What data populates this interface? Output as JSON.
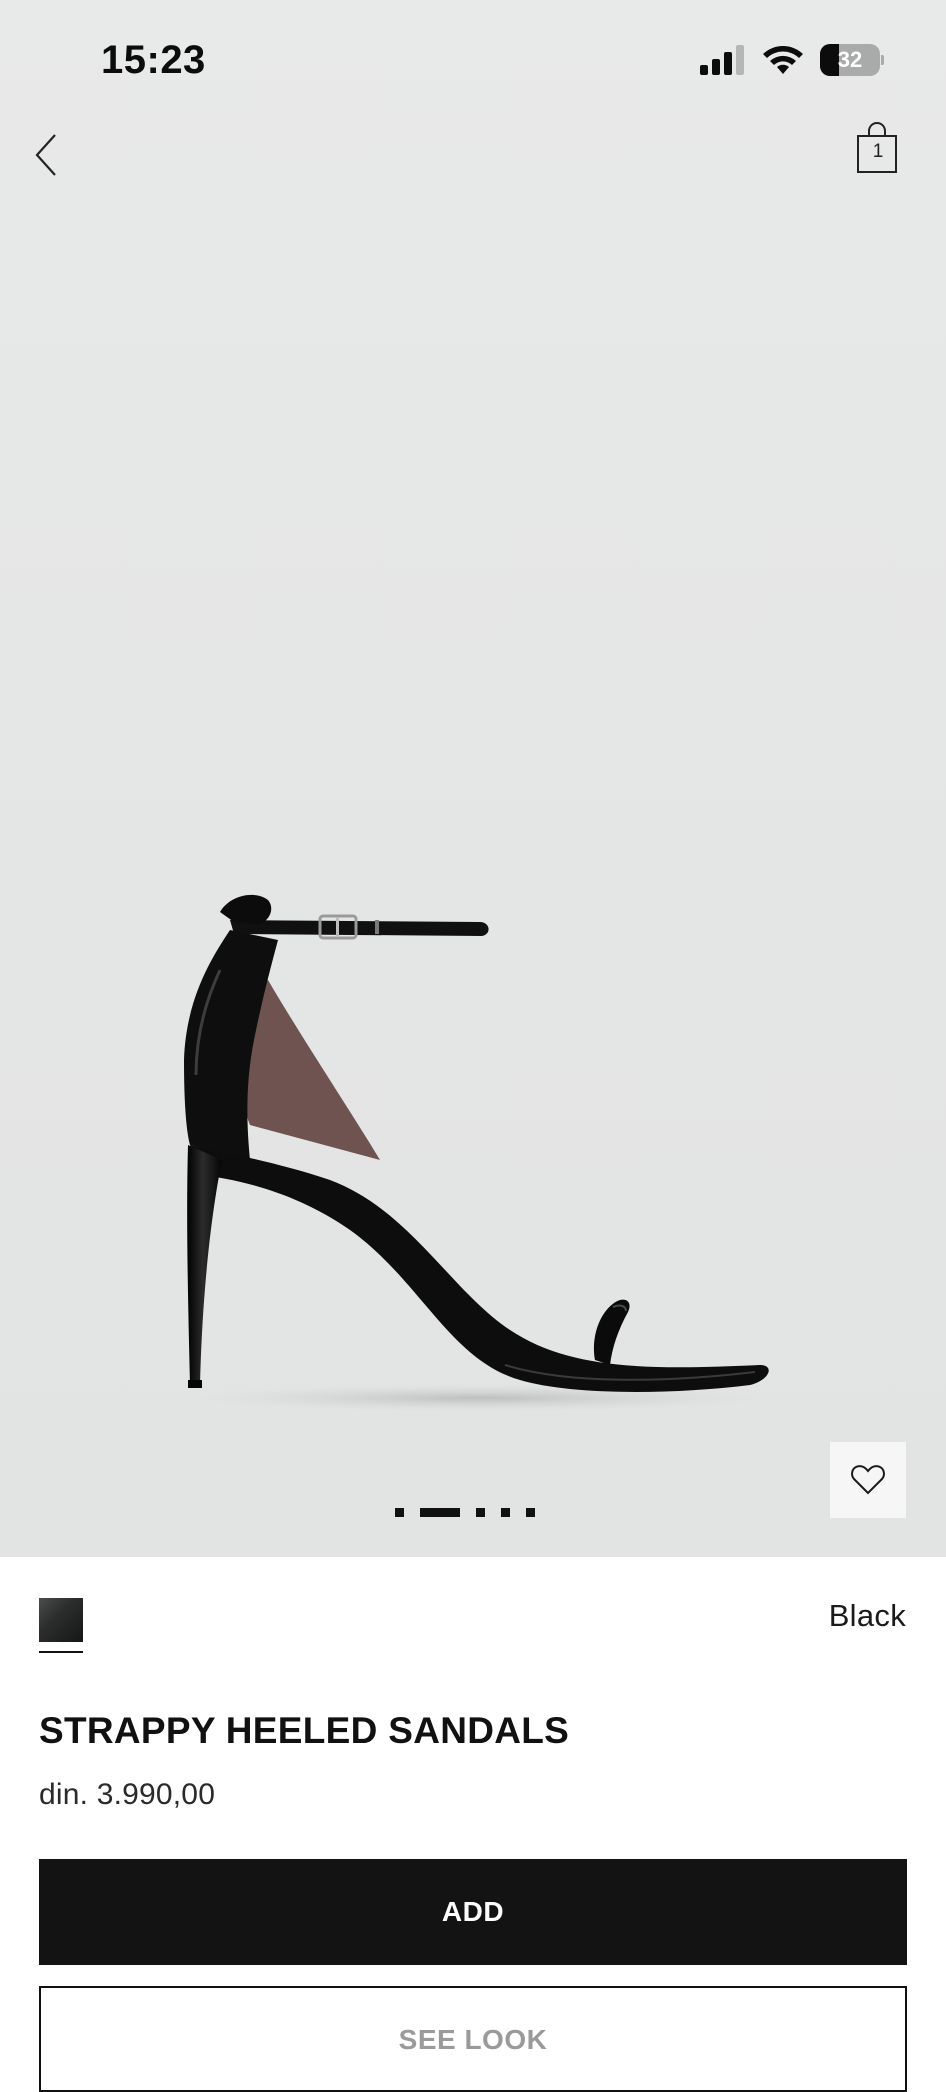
{
  "status_bar": {
    "time": "15:23",
    "battery_level": "32"
  },
  "nav": {
    "back_icon": "chevron-left-icon",
    "bag_icon": "shopping-bag-icon",
    "bag_count": "1"
  },
  "gallery": {
    "image_subject": "black strappy heeled sandal",
    "image_count": 5,
    "active_index": 1,
    "wishlist_icon": "heart-icon"
  },
  "product": {
    "swatch_color": "#222524",
    "color_name": "Black",
    "title": "STRAPPY HEELED SANDALS",
    "price": "din. 3.990,00"
  },
  "actions": {
    "add_label": "ADD",
    "see_look_label": "SEE LOOK"
  },
  "colors": {
    "hero_background": "#e6e7e7",
    "button_dark": "#131313",
    "text": "#111111"
  }
}
